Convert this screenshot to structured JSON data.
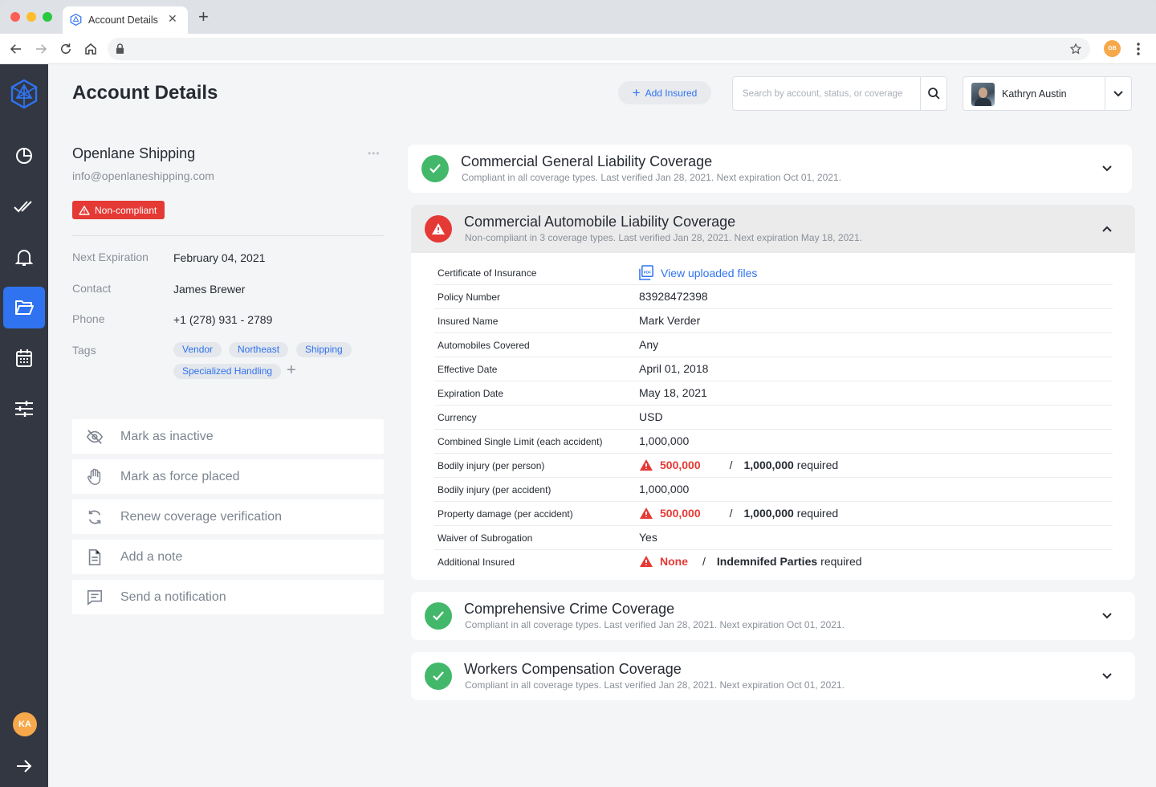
{
  "browser": {
    "tab_title": "Account Details",
    "profile_initials": "GB"
  },
  "header": {
    "title": "Account Details",
    "add_insured_label": "Add Insured",
    "search_placeholder": "Search by account, status, or coverage",
    "user_name": "Kathryn Austin"
  },
  "sidebar": {
    "items": [
      "dashboard-icon",
      "tasks-icon",
      "notifications-icon",
      "accounts-folder-icon",
      "calendar-icon",
      "settings-sliders-icon"
    ],
    "active": "accounts-folder-icon",
    "avatar_initials": "KA"
  },
  "account": {
    "name": "Openlane Shipping",
    "email": "info@openlaneshipping.com",
    "status": "Non-compliant",
    "details": [
      {
        "label": "Next Expiration",
        "value": "February 04, 2021"
      },
      {
        "label": "Contact",
        "value": "James Brewer"
      },
      {
        "label": "Phone",
        "value": "+1 (278) 931 - 2789"
      }
    ],
    "tags_label": "Tags",
    "tags": [
      "Vendor",
      "Northeast",
      "Shipping",
      "Specialized Handling"
    ],
    "actions": [
      {
        "label": "Mark as inactive",
        "icon": "eye-off-icon"
      },
      {
        "label": "Mark as force placed",
        "icon": "hand-icon"
      },
      {
        "label": "Renew coverage verification",
        "icon": "refresh-icon"
      },
      {
        "label": "Add a note",
        "icon": "note-icon"
      },
      {
        "label": "Send a notification",
        "icon": "message-icon"
      }
    ]
  },
  "coverages": [
    {
      "title": "Commercial General Liability Coverage",
      "status": "compliant",
      "summary": "Compliant in all coverage types. Last verified Jan 28, 2021. Next expiration Oct 01, 2021."
    },
    {
      "title": "Commercial Automobile Liability Coverage",
      "status": "non-compliant",
      "summary": "Non-compliant in 3 coverage types. Last verified Jan 28, 2021. Next expiration May 18, 2021."
    },
    {
      "title": "Comprehensive Crime Coverage",
      "status": "compliant",
      "summary": "Compliant in all coverage types. Last verified Jan 28, 2021. Next expiration Oct 01, 2021."
    },
    {
      "title": "Workers Compensation Coverage",
      "status": "compliant",
      "summary": "Compliant in all coverage types. Last verified Jan 28, 2021. Next expiration Oct 01, 2021."
    }
  ],
  "auto_details": [
    {
      "label": "Certificate of Insurance",
      "value": "View uploaded files"
    },
    {
      "label": "Policy Number",
      "value": "83928472398"
    },
    {
      "label": "Insured Name",
      "value": "Mark Verder"
    },
    {
      "label": "Automobiles Covered",
      "value": "Any"
    },
    {
      "label": "Effective Date",
      "value": "April 01, 2018"
    },
    {
      "label": "Expiration Date",
      "value": "May 18, 2021"
    },
    {
      "label": "Currency",
      "value": "USD"
    },
    {
      "label": "Combined Single Limit (each accident)",
      "value": "1,000,000"
    },
    {
      "label": "Bodily injury (per person)",
      "actual": "500,000",
      "required": "1,000,000",
      "suffix": "required"
    },
    {
      "label": "Bodily injury (per accident)",
      "value": "1,000,000"
    },
    {
      "label": "Property damage (per accident)",
      "actual": "500,000",
      "required": "1,000,000",
      "suffix": "required"
    },
    {
      "label": "Waiver of Subrogation",
      "value": "Yes"
    },
    {
      "label": "Additional Insured",
      "actual": "None",
      "required": "Indemnifed Parties",
      "suffix": "required"
    }
  ],
  "colors": {
    "accent": "#2f73f0",
    "sidebar": "#333742",
    "compliant": "#43b86a",
    "non_compliant": "#e53935"
  }
}
